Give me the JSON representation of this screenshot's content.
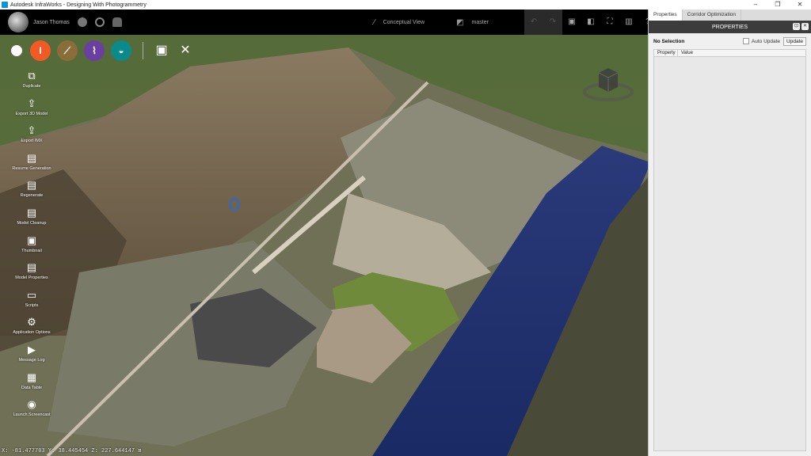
{
  "window": {
    "title": "Autodesk InfraWorks - Designing With Photogrammetry",
    "controls": [
      "–",
      "❐",
      "✕"
    ]
  },
  "topbar": {
    "user": "Jason Thomas",
    "view_label": "Conceptual View",
    "proposal_label": "master"
  },
  "toolrow": {
    "tools": [
      {
        "name": "build-tool",
        "color": "#f15a24"
      },
      {
        "name": "roads-tool",
        "color": "#8a6d3b"
      },
      {
        "name": "bridge-tool",
        "color": "#6a3fa0"
      },
      {
        "name": "drainage-tool",
        "color": "#0a8a8a"
      }
    ]
  },
  "sidemenu": {
    "items": [
      {
        "label": "Duplicate",
        "icon": "duplicate-icon",
        "glyph": "⧉"
      },
      {
        "label": "Export 3D Model",
        "icon": "export-3d-icon",
        "glyph": "⇪"
      },
      {
        "label": "Export IMX",
        "icon": "export-imx-icon",
        "glyph": "⇪"
      },
      {
        "label": "Resume Generation",
        "icon": "resume-icon",
        "glyph": "▤"
      },
      {
        "label": "Regenerate",
        "icon": "regenerate-icon",
        "glyph": "▤"
      },
      {
        "label": "Model Cleanup",
        "icon": "cleanup-icon",
        "glyph": "▤"
      },
      {
        "label": "Thumbnail",
        "icon": "thumbnail-icon",
        "glyph": "▣"
      },
      {
        "label": "Model Properties",
        "icon": "properties-icon",
        "glyph": "▤"
      },
      {
        "label": "Scripts",
        "icon": "scripts-icon",
        "glyph": "▭"
      },
      {
        "label": "Application Options",
        "icon": "gear-icon",
        "glyph": "⚙"
      },
      {
        "label": "Message Log",
        "icon": "play-icon",
        "glyph": "▶"
      },
      {
        "label": "Data Table",
        "icon": "table-icon",
        "glyph": "▦"
      },
      {
        "label": "Launch Screencast",
        "icon": "screencast-icon",
        "glyph": "◉"
      }
    ]
  },
  "status": {
    "coords": "X: -81.477703 Y: 38.445454 Z: 227.644147 m"
  },
  "panel": {
    "tabs": [
      "Properties",
      "Corridor Optimization"
    ],
    "header": "PROPERTIES",
    "selection": "No Selection",
    "auto_update_label": "Auto Update",
    "update_button": "Update",
    "columns": [
      "Property",
      "Value"
    ]
  }
}
